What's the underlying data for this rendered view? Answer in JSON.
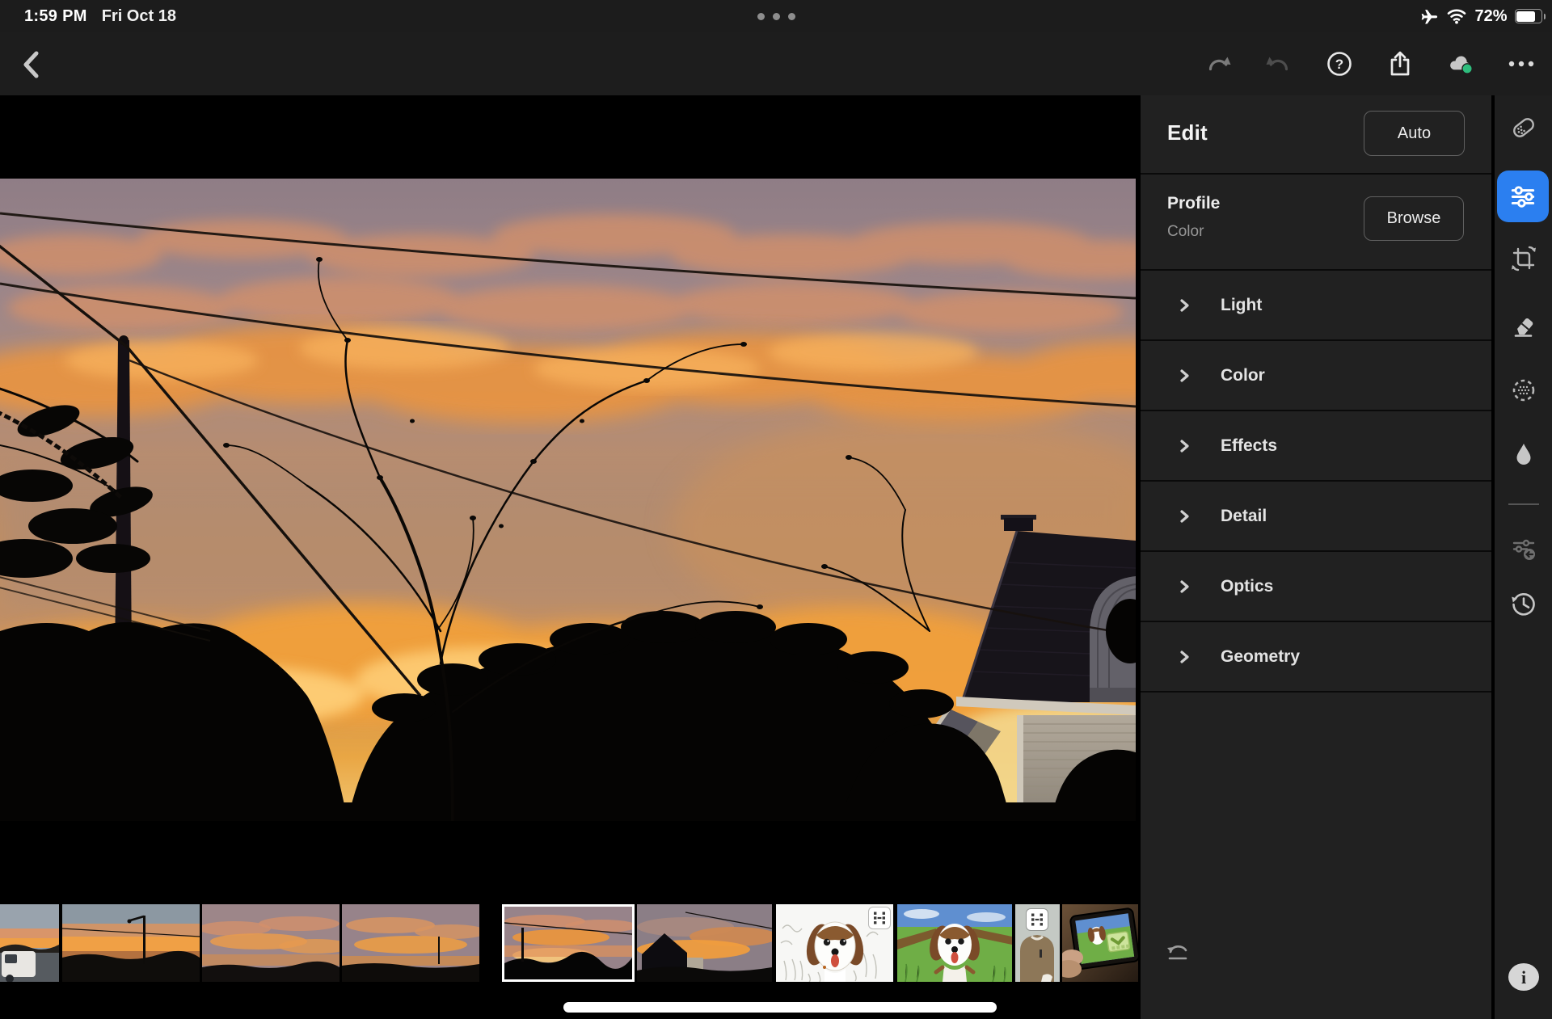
{
  "status_bar": {
    "time": "1:59 PM",
    "date": "Fri Oct 18",
    "battery_percent": "72%",
    "right_icons": [
      "airplane-mode-icon",
      "wifi-icon",
      "battery-icon"
    ]
  },
  "toolbar": {
    "left_icons": [
      "back-icon"
    ],
    "right_icons": [
      "redo-icon",
      "undo-icon",
      "help-icon",
      "share-icon",
      "cloud-sync-icon",
      "more-icon"
    ],
    "cloud_sync_state": "synced"
  },
  "edit_panel": {
    "title": "Edit",
    "auto_button": "Auto",
    "profile_label": "Profile",
    "profile_value": "Color",
    "browse_button": "Browse",
    "sections": [
      {
        "label": "Light"
      },
      {
        "label": "Color"
      },
      {
        "label": "Effects"
      },
      {
        "label": "Detail"
      },
      {
        "label": "Optics"
      },
      {
        "label": "Geometry"
      }
    ]
  },
  "tool_rail": {
    "tools": [
      {
        "name": "heal",
        "selected": false
      },
      {
        "name": "edit-adjustments",
        "selected": true
      },
      {
        "name": "crop",
        "selected": false
      },
      {
        "name": "eraser",
        "selected": false
      },
      {
        "name": "selective-mask",
        "selected": false
      },
      {
        "name": "droplet",
        "selected": false
      },
      {
        "name": "previous-settings",
        "selected": false
      },
      {
        "name": "versions",
        "selected": false
      }
    ],
    "bottom_icons": [
      "info-icon"
    ]
  },
  "filmstrip": {
    "selected_index": 4,
    "items": [
      {
        "kind": "photo-sunset-truck"
      },
      {
        "kind": "photo-sunset-streetlight"
      },
      {
        "kind": "photo-sunset-clouds"
      },
      {
        "kind": "photo-sunset-clouds"
      },
      {
        "kind": "photo-sunset-trees",
        "selected": true
      },
      {
        "kind": "photo-sunset-house"
      },
      {
        "kind": "video-beagle-sketch",
        "badge": "video"
      },
      {
        "kind": "photo-beagle-painting"
      },
      {
        "kind": "video-person",
        "badge": "video"
      },
      {
        "kind": "photo-tablet-in-hand",
        "badge": "download-complete"
      }
    ]
  },
  "colors": {
    "accent_blue": "#2b7ff0",
    "sync_green": "#2ebd7d",
    "panel_bg": "#212121",
    "chrome_bg": "#1d1d1d",
    "black": "#000000"
  }
}
